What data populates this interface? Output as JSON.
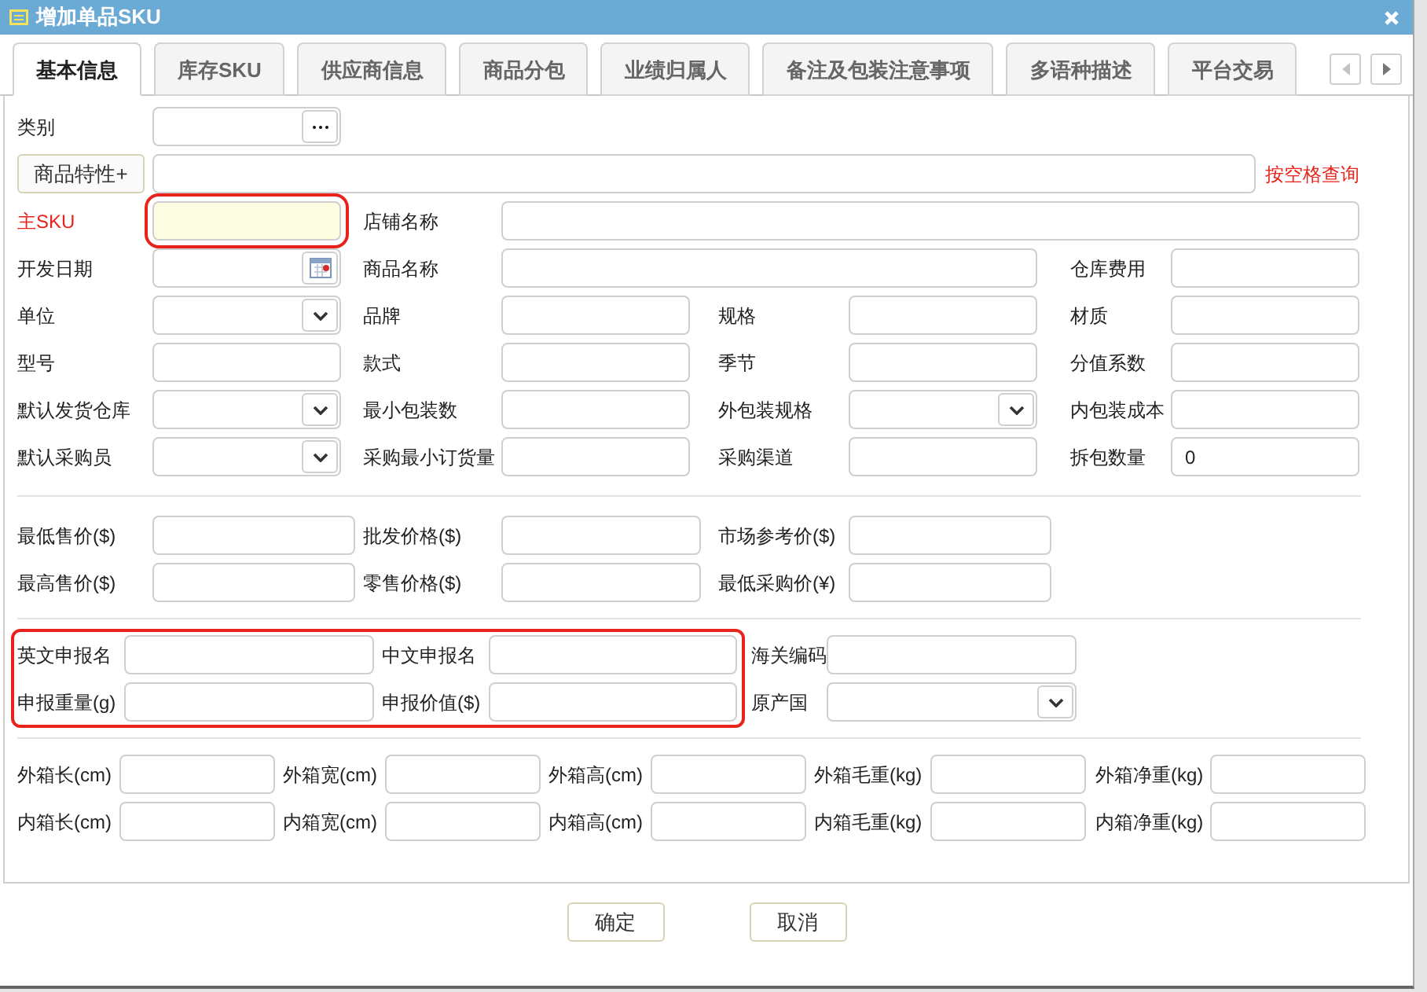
{
  "window": {
    "title": "增加单品SKU"
  },
  "tabs": [
    {
      "label": "基本信息",
      "selected": true
    },
    {
      "label": "库存SKU",
      "selected": false
    },
    {
      "label": "供应商信息",
      "selected": false
    },
    {
      "label": "商品分包",
      "selected": false
    },
    {
      "label": "业绩归属人",
      "selected": false
    },
    {
      "label": "备注及包装注意事项",
      "selected": false
    },
    {
      "label": "多语种描述",
      "selected": false
    },
    {
      "label": "平台交易",
      "selected": false
    }
  ],
  "tab_scroll": [
    {
      "kind": "left",
      "disabled": true
    },
    {
      "kind": "right",
      "disabled": false
    }
  ],
  "sections": [
    {
      "kind": "basic",
      "groups": [
        {
          "highlighted": false,
          "rows": [
            [
              {
                "label": "类别",
                "kind": "picker"
              }
            ],
            {
              "kind": "search",
              "button": "商品特性+",
              "hint": "按空格查询"
            },
            [
              {
                "label": "主SKU",
                "kind": "required"
              },
              {
                "label": "店铺名称",
                "kind": "text"
              }
            ],
            [
              {
                "label": "开发日期",
                "kind": "date"
              },
              {
                "label": "商品名称",
                "kind": "text"
              },
              {
                "label": "仓库费用",
                "kind": "text"
              }
            ],
            [
              {
                "label": "单位",
                "kind": "select"
              },
              {
                "label": "品牌",
                "kind": "text"
              },
              {
                "label": "规格",
                "kind": "text"
              },
              {
                "label": "材质",
                "kind": "text"
              }
            ],
            [
              {
                "label": "型号",
                "kind": "text"
              },
              {
                "label": "款式",
                "kind": "text"
              },
              {
                "label": "季节",
                "kind": "text"
              },
              {
                "label": "分值系数",
                "kind": "text"
              }
            ],
            [
              {
                "label": "默认发货仓库",
                "kind": "select"
              },
              {
                "label": "最小包装数",
                "kind": "text"
              },
              {
                "label": "外包装规格",
                "kind": "select"
              },
              {
                "label": "内包装成本",
                "kind": "text"
              }
            ],
            [
              {
                "label": "默认采购员",
                "kind": "select"
              },
              {
                "label": "采购最小订货量",
                "kind": "text"
              },
              {
                "label": "采购渠道",
                "kind": "text"
              },
              {
                "label": "拆包数量",
                "kind": "text",
                "value": "0"
              }
            ]
          ]
        }
      ]
    },
    {
      "kind": "price",
      "groups": [
        {
          "highlighted": false,
          "rows": [
            [
              {
                "label": "最低售价($)",
                "kind": "text"
              },
              {
                "label": "批发价格($)",
                "kind": "text"
              },
              {
                "label": "市场参考价($)",
                "kind": "text"
              }
            ],
            [
              {
                "label": "最高售价($)",
                "kind": "text"
              },
              {
                "label": "零售价格($)",
                "kind": "text"
              },
              {
                "label": "最低采购价(¥)",
                "kind": "text"
              }
            ]
          ]
        }
      ]
    },
    {
      "kind": "customs",
      "groups": [
        {
          "highlighted": true,
          "rows": [
            [
              {
                "label": "英文申报名",
                "kind": "text"
              },
              {
                "label": "中文申报名",
                "kind": "text"
              }
            ],
            [
              {
                "label": "申报重量(g)",
                "kind": "text"
              },
              {
                "label": "申报价值($)",
                "kind": "text"
              }
            ]
          ]
        },
        {
          "highlighted": false,
          "rows": [
            [
              {
                "label": "海关编码",
                "kind": "text"
              }
            ],
            [
              {
                "label": "原产国",
                "kind": "select"
              }
            ]
          ]
        }
      ]
    },
    {
      "kind": "carton",
      "groups": [
        {
          "highlighted": false,
          "rows": [
            [
              {
                "label": "外箱长(cm)",
                "kind": "text"
              },
              {
                "label": "外箱宽(cm)",
                "kind": "text"
              },
              {
                "label": "外箱高(cm)",
                "kind": "text"
              },
              {
                "label": "外箱毛重(kg)",
                "kind": "text"
              },
              {
                "label": "外箱净重(kg)",
                "kind": "text"
              }
            ],
            [
              {
                "label": "内箱长(cm)",
                "kind": "text"
              },
              {
                "label": "内箱宽(cm)",
                "kind": "text"
              },
              {
                "label": "内箱高(cm)",
                "kind": "text"
              },
              {
                "label": "内箱毛重(kg)",
                "kind": "text"
              },
              {
                "label": "内箱净重(kg)",
                "kind": "text"
              }
            ]
          ]
        }
      ]
    }
  ],
  "buttons": [
    {
      "label": "确定"
    },
    {
      "label": "取消"
    }
  ]
}
